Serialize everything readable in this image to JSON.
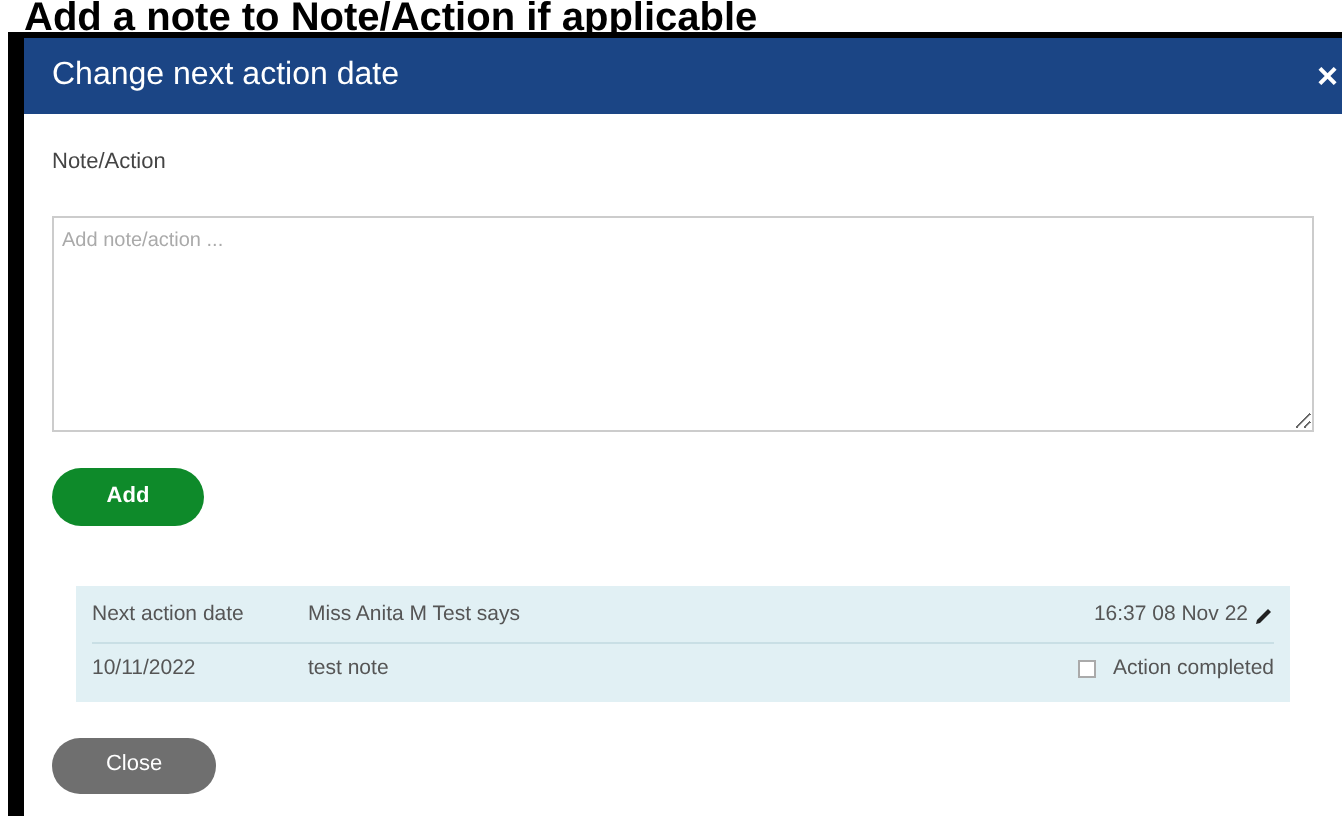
{
  "page_heading": "Add a note to Note/Action if applicable",
  "dialog": {
    "title": "Change next action date",
    "close": "×",
    "field_label": "Note/Action",
    "note_field": {
      "placeholder": "Add note/action ..."
    },
    "add_button": "Add",
    "notes": [
      {
        "type": "Next action date",
        "author": "Miss Anita M Test says",
        "timestamp": "16:37 08 Nov 22",
        "date": "10/11/2022",
        "text": "test note",
        "action_label": "Action completed",
        "checked": false
      }
    ],
    "close_button": "Close"
  }
}
